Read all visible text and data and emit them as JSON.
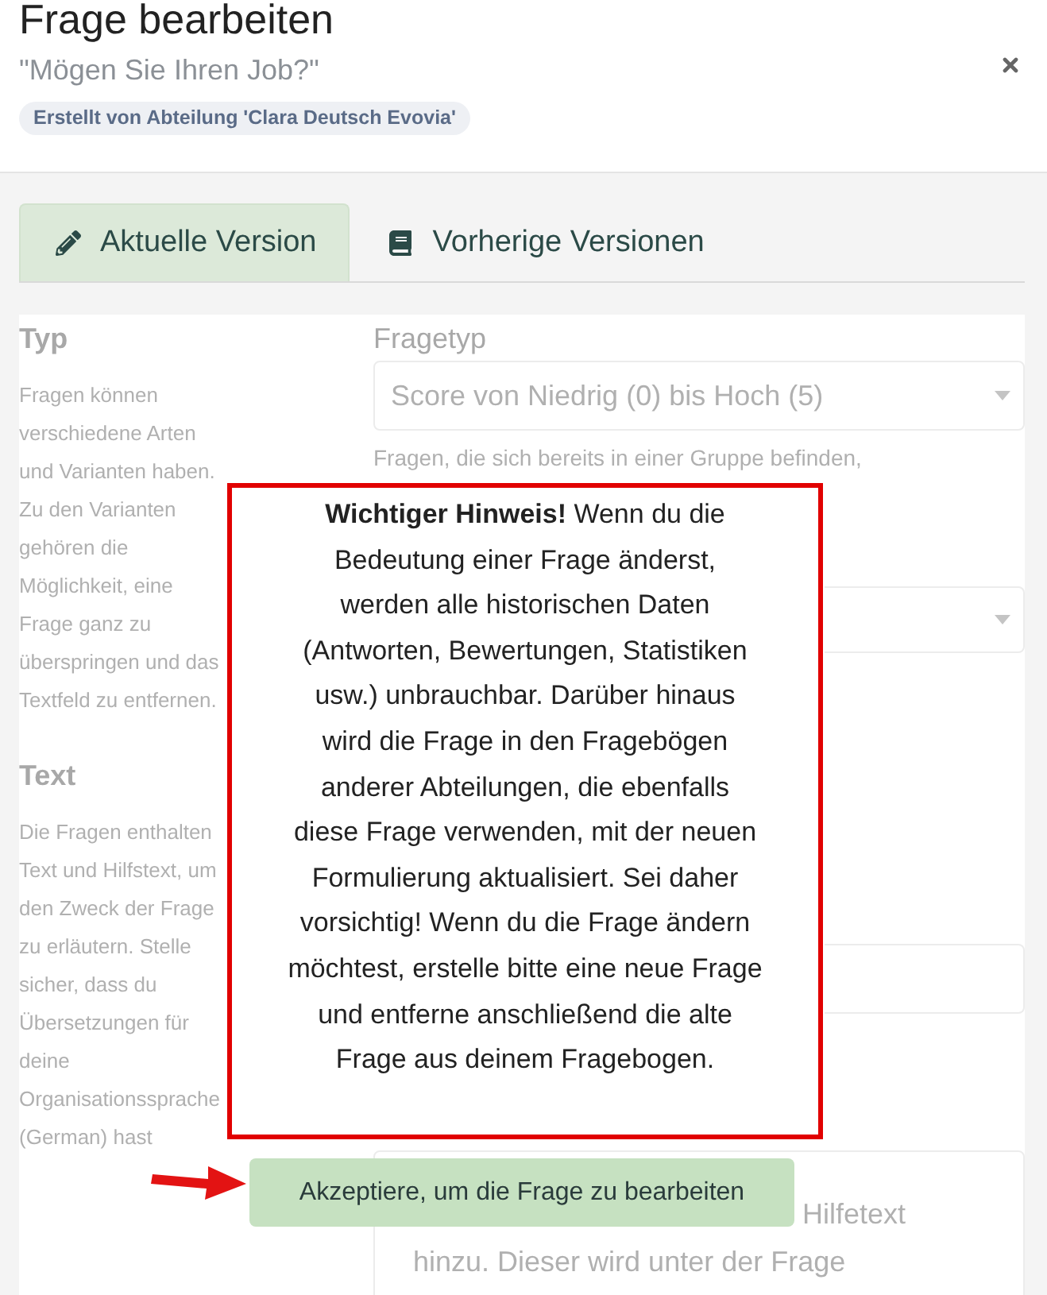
{
  "dialog": {
    "title": "Frage bearbeiten",
    "subtitle": "\"Mögen Sie Ihren Job?\"",
    "badge": "Erstellt von Abteilung 'Clara Deutsch Evovia'"
  },
  "tabs": [
    {
      "label": "Aktuelle Version",
      "selected": true
    },
    {
      "label": "Vorherige Versionen",
      "selected": false
    }
  ],
  "form": {
    "sections": [
      {
        "heading": "Typ",
        "description": "Fragen können verschiedene Arten und Varianten haben. Zu den Varianten gehören die Möglichkeit, eine Frage ganz zu überspringen und das Textfeld zu entfernen."
      },
      {
        "heading": "Text",
        "description": "Die Fragen enthalten Text und Hilfstext, um den Zweck der Frage zu erläutern. Stelle sicher, dass du Übersetzungen für deine Organisationssprache (German) hast"
      }
    ],
    "fields": [
      {
        "kind": "select",
        "label": "Fragetyp",
        "value": "Score von Niedrig (0) bis Hoch (5)",
        "help_text": "Fragen, die sich bereits in einer Gruppe befinden,"
      },
      {
        "kind": "select"
      },
      {
        "kind": "input"
      },
      {
        "kind": "textarea",
        "placeholder": "Hilfetext hinzu. Dieser wird unter der Frage"
      }
    ]
  },
  "notice": {
    "text": "**Wichtiger Hinweis!** Wenn du die Bedeutung einer Frage änderst, werden alle historischen Daten (Antworten, Bewertungen, Statistiken usw.) unbrauchbar. Darüber hinaus wird die Frage in den Fragebögen anderer Abteilungen, die ebenfalls diese Frage verwenden, mit der neuen Formulierung aktualisiert. Sei daher vorsichtig! Wenn du die Frage ändern möchtest, erstelle bitte eine neue Frage und entferne anschließend die alte Frage aus deinem Fragebogen."
  },
  "accept_button": {
    "label": "Akzeptiere, um die Frage zu bearbeiten"
  }
}
